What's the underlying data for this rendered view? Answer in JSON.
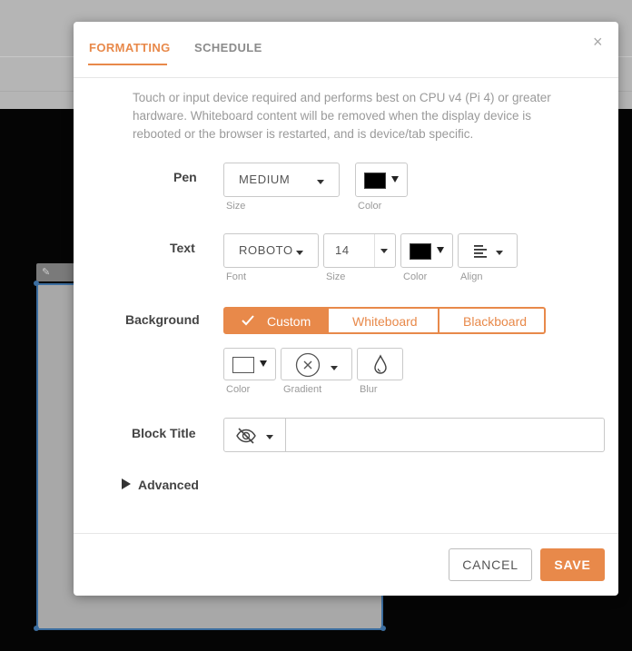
{
  "tabs": [
    {
      "label": "FORMATTING",
      "active": true
    },
    {
      "label": "SCHEDULE",
      "active": false
    }
  ],
  "close_glyph": "×",
  "notice": "Touch or input device required and performs best on CPU v4 (Pi 4) or greater hardware. Whiteboard content will be removed when the display device is rebooted or the browser is restarted, and is device/tab specific.",
  "pen": {
    "label": "Pen",
    "size_value": "MEDIUM",
    "size_label": "Size",
    "color_label": "Color",
    "color": "#000000"
  },
  "text": {
    "label": "Text",
    "font_value": "ROBOTO",
    "font_label": "Font",
    "size_value": "14",
    "size_label": "Size",
    "color_label": "Color",
    "color": "#000000",
    "align_label": "Align",
    "align_icon": "align-left-icon"
  },
  "background": {
    "label": "Background",
    "options": [
      "Custom",
      "Whiteboard",
      "Blackboard"
    ],
    "selected": "Custom",
    "color_label": "Color",
    "color": "#ffffff",
    "gradient_label": "Gradient",
    "gradient_icon": "no-gradient-icon",
    "blur_label": "Blur",
    "blur_icon": "droplet-icon"
  },
  "block_title": {
    "label": "Block Title",
    "visibility_icon": "eye-slash-icon",
    "value": ""
  },
  "advanced_label": "Advanced",
  "buttons": {
    "cancel": "CANCEL",
    "save": "SAVE"
  },
  "colors": {
    "accent": "#e8894a",
    "backdrop": "#000000",
    "selection": "#3c6ea0"
  }
}
